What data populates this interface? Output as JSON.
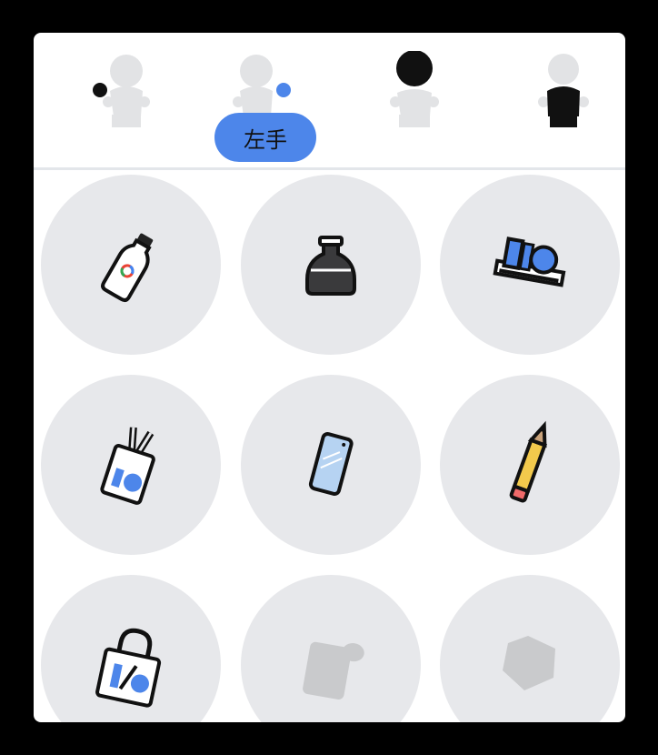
{
  "slots": {
    "tooltip_label": "左手",
    "items": [
      {
        "name": "slot-left-hand-outline",
        "selected": false
      },
      {
        "name": "slot-right-hand",
        "selected": true
      },
      {
        "name": "slot-head",
        "selected": false
      },
      {
        "name": "slot-body",
        "selected": false
      }
    ]
  },
  "colors": {
    "panel": "#ffffff",
    "item_bg": "#e7e8eb",
    "accent_blue": "#4d86ea",
    "silhouette": "#e2e3e5",
    "dark": "#111111",
    "locked": "#c9cacc"
  },
  "items": [
    {
      "icon": "water-bottle-icon",
      "locked": false
    },
    {
      "icon": "ink-bottle-icon",
      "locked": false
    },
    {
      "icon": "desk-organizer-icon",
      "locked": false
    },
    {
      "icon": "lanyard-badge-icon",
      "locked": false
    },
    {
      "icon": "smartphone-icon",
      "locked": false
    },
    {
      "icon": "pencil-icon",
      "locked": false
    },
    {
      "icon": "tote-bag-icon",
      "locked": false
    },
    {
      "icon": "locked-mug-icon",
      "locked": true
    },
    {
      "icon": "locked-pentagon-icon",
      "locked": true
    }
  ]
}
